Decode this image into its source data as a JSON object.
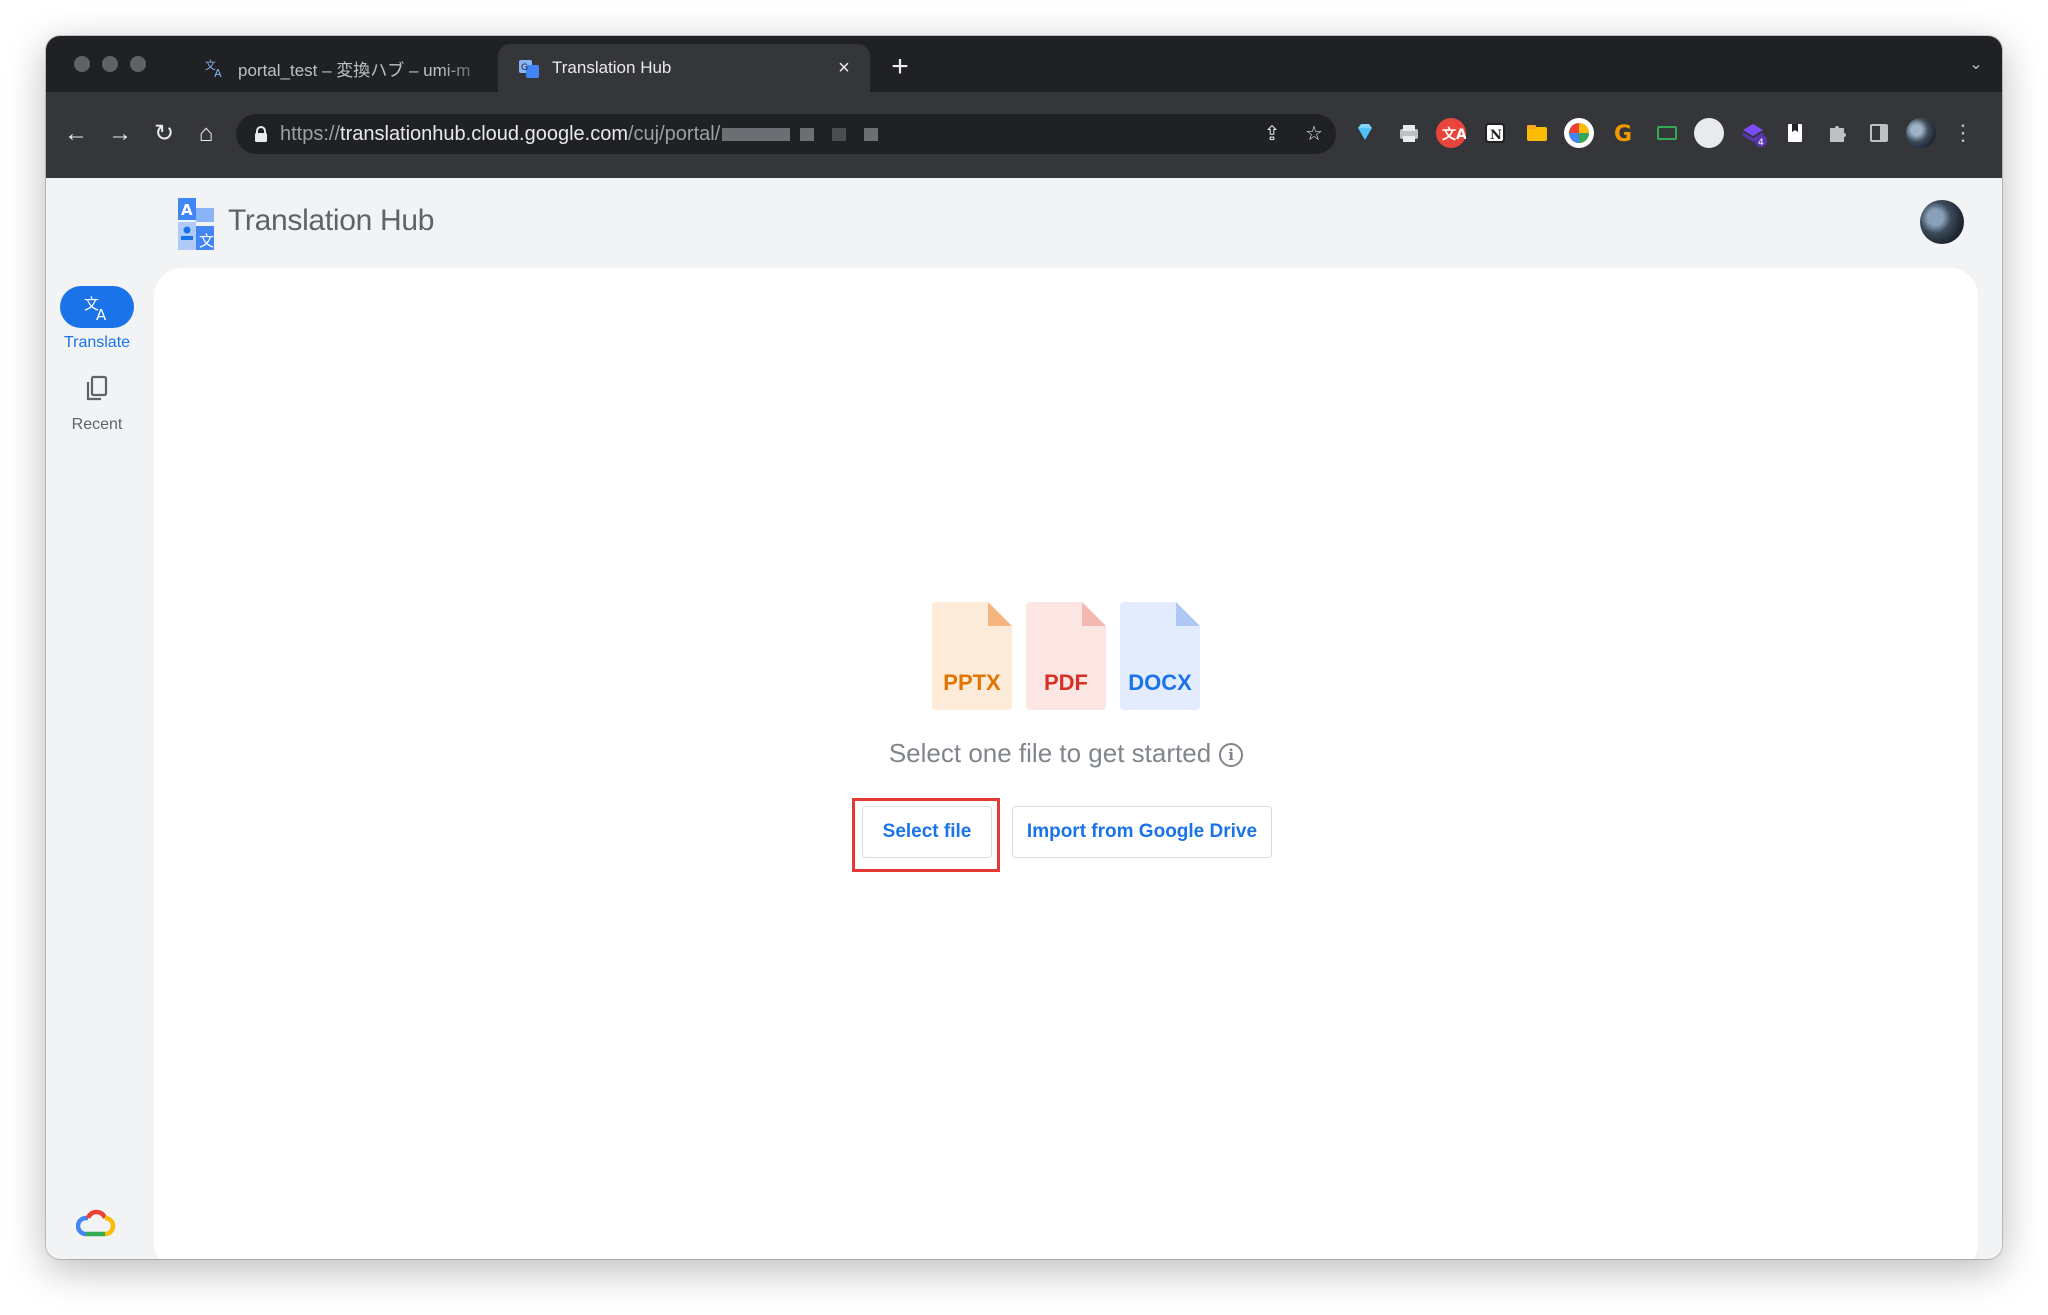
{
  "browser": {
    "tabs": [
      {
        "title": "portal_test – 変換ハブ – umi-m",
        "active": false
      },
      {
        "title": "Translation Hub",
        "active": true
      }
    ],
    "url": {
      "scheme": "https://",
      "host": "translationhub.cloud.google.com",
      "path": "/cuj/portal/"
    }
  },
  "app": {
    "title": "Translation Hub",
    "nav": [
      {
        "label": "Translate",
        "icon": "translate-icon",
        "active": true
      },
      {
        "label": "Recent",
        "icon": "copy-icon",
        "active": false
      }
    ]
  },
  "main": {
    "file_types": [
      {
        "label": "PPTX",
        "color": "#e37400",
        "bg": "#fdebd9"
      },
      {
        "label": "PDF",
        "color": "#d93025",
        "bg": "#fbe6e4"
      },
      {
        "label": "DOCX",
        "color": "#1a73e8",
        "bg": "#e3ecfc"
      }
    ],
    "prompt": "Select one file to get started",
    "select_button": "Select file",
    "import_button": "Import from Google Drive"
  },
  "colors": {
    "accent": "#1a73e8",
    "highlight": "#e53935"
  }
}
